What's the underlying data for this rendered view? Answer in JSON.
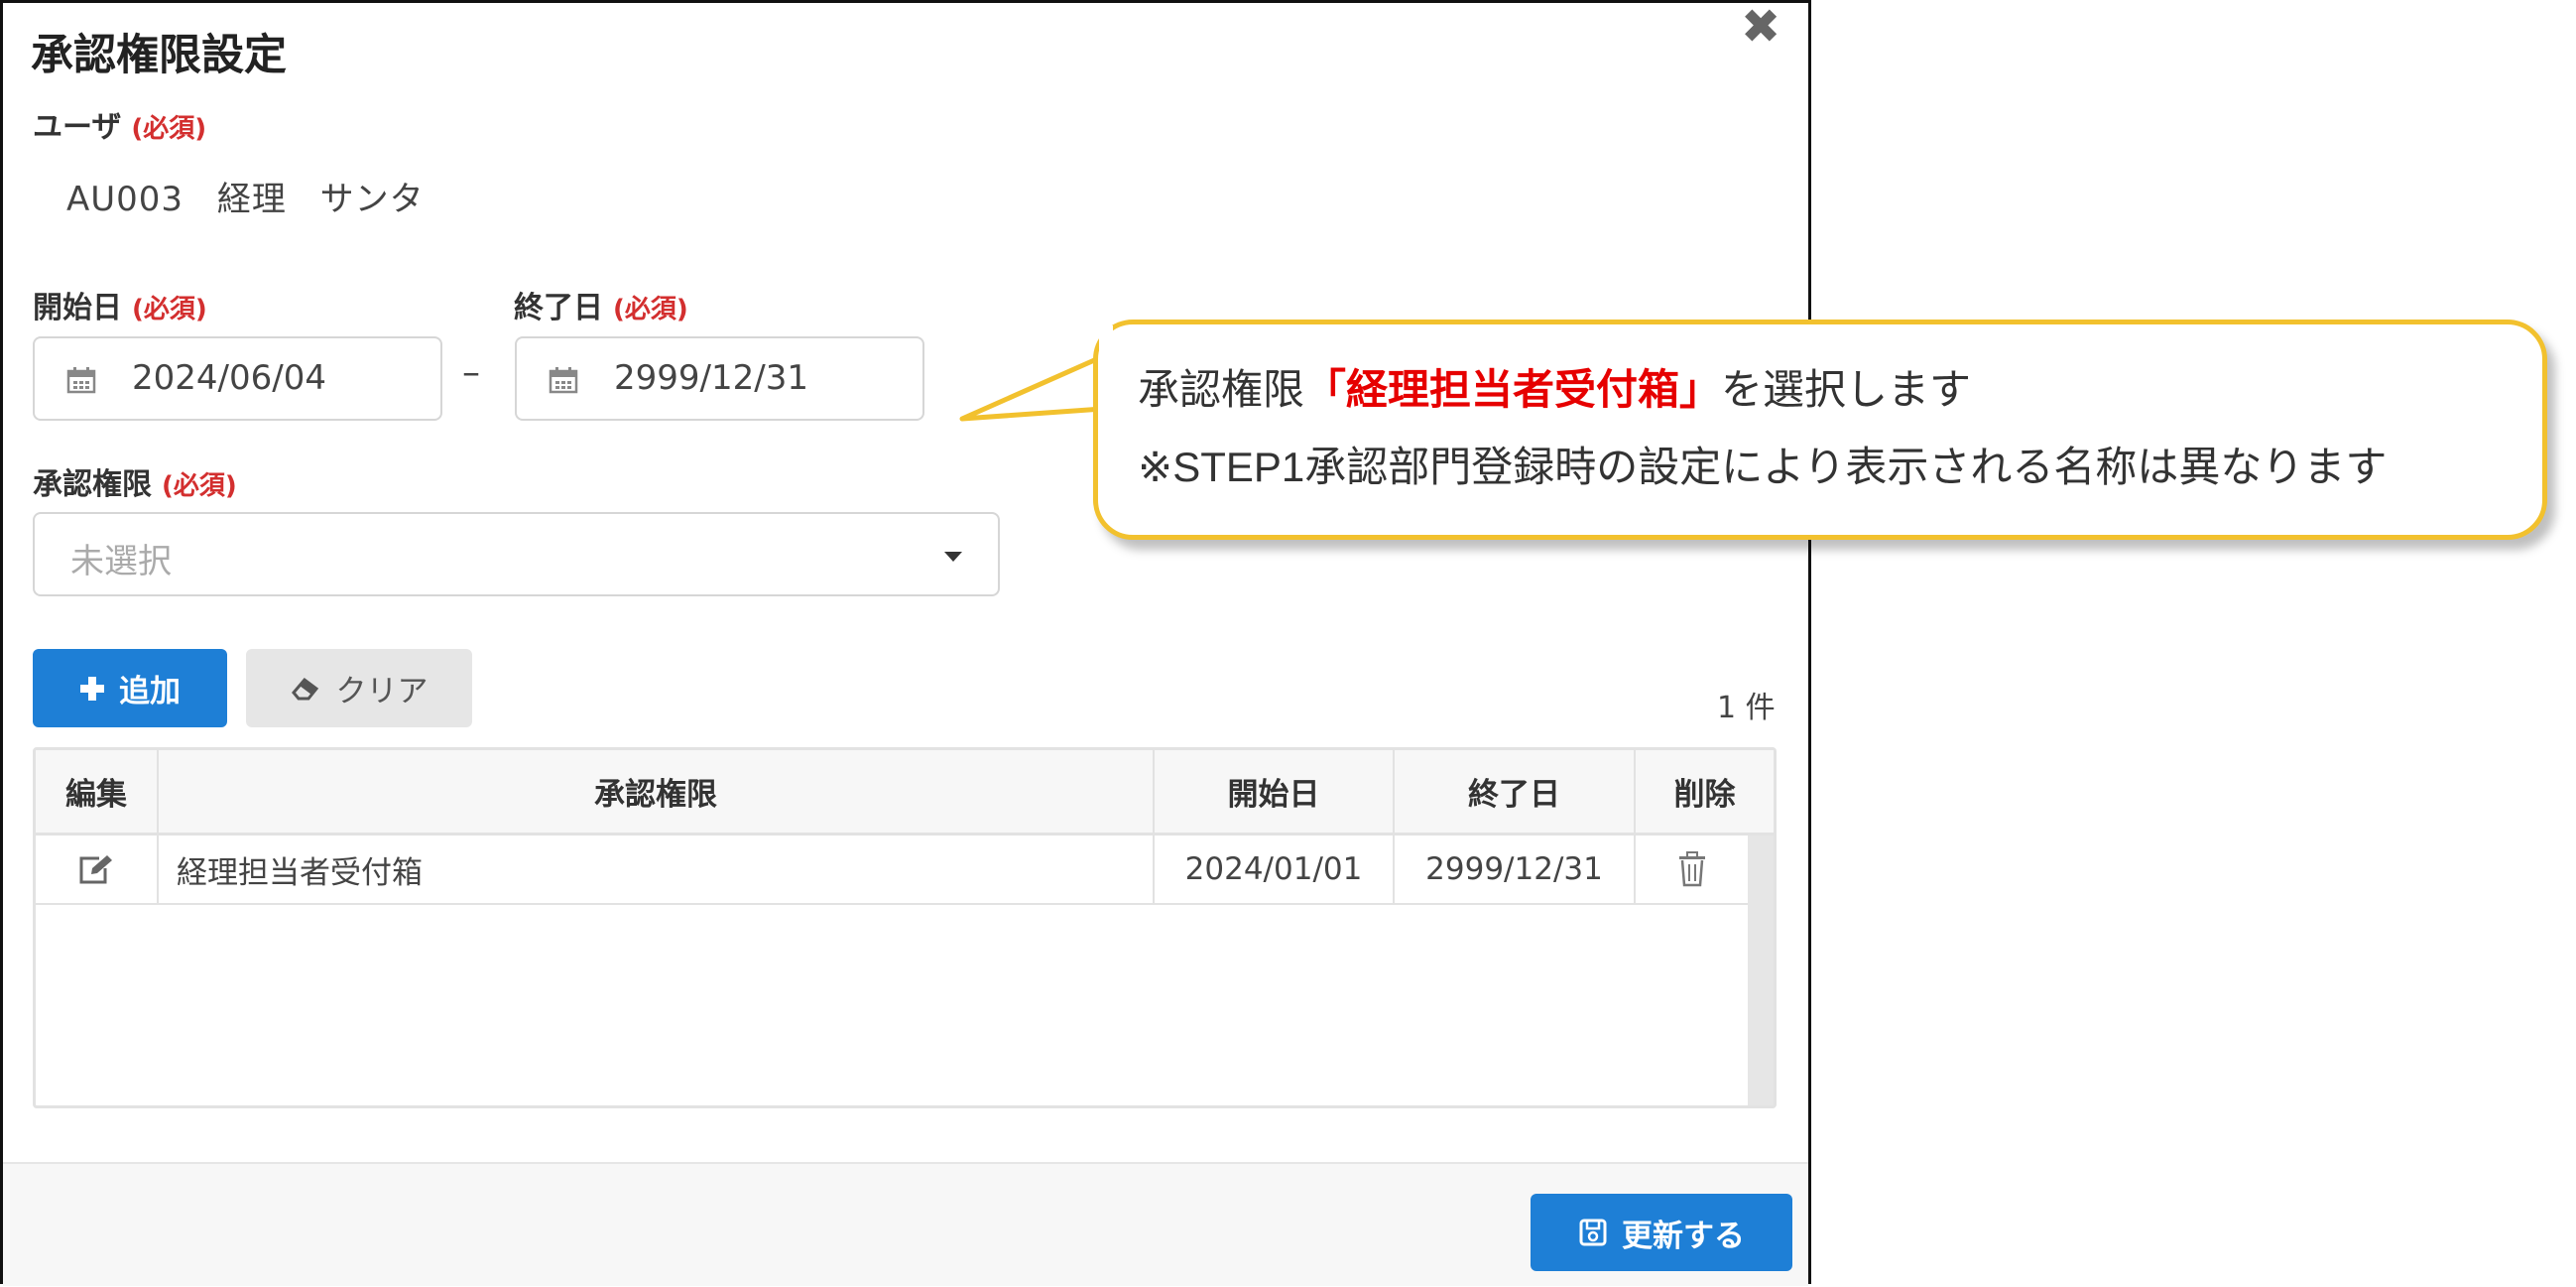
{
  "dialog": {
    "title": "承認権限設定",
    "close_glyph": "✖"
  },
  "user": {
    "label": "ユーザ",
    "required": "(必須)",
    "value": "AU003 経理 サンタ"
  },
  "dates": {
    "start_label": "開始日",
    "end_label": "終了日",
    "required": "(必須)",
    "start_value": "2024/06/04",
    "end_value": "2999/12/31",
    "separator": "–"
  },
  "permission": {
    "label": "承認権限",
    "required": "(必須)",
    "placeholder": "未選択"
  },
  "actions": {
    "add_label": "追加",
    "clear_label": "クリア",
    "count": "1 件"
  },
  "table": {
    "headers": [
      "編集",
      "承認権限",
      "開始日",
      "終了日",
      "削除"
    ],
    "rows": [
      {
        "permission": "経理担当者受付箱",
        "start": "2024/01/01",
        "end": "2999/12/31"
      }
    ]
  },
  "footer": {
    "update_label": "更新する"
  },
  "callout": {
    "line1_prefix": "承認権限",
    "line1_highlight": "「経理担当者受付箱」",
    "line1_suffix": "を選択します",
    "line2": "※STEP1承認部門登録時の設定により表示される名称は異なります"
  },
  "colors": {
    "primary": "#1e7fd6",
    "required": "#d32f2f",
    "callout_border": "#f2c12e",
    "callout_highlight": "#e60000"
  }
}
